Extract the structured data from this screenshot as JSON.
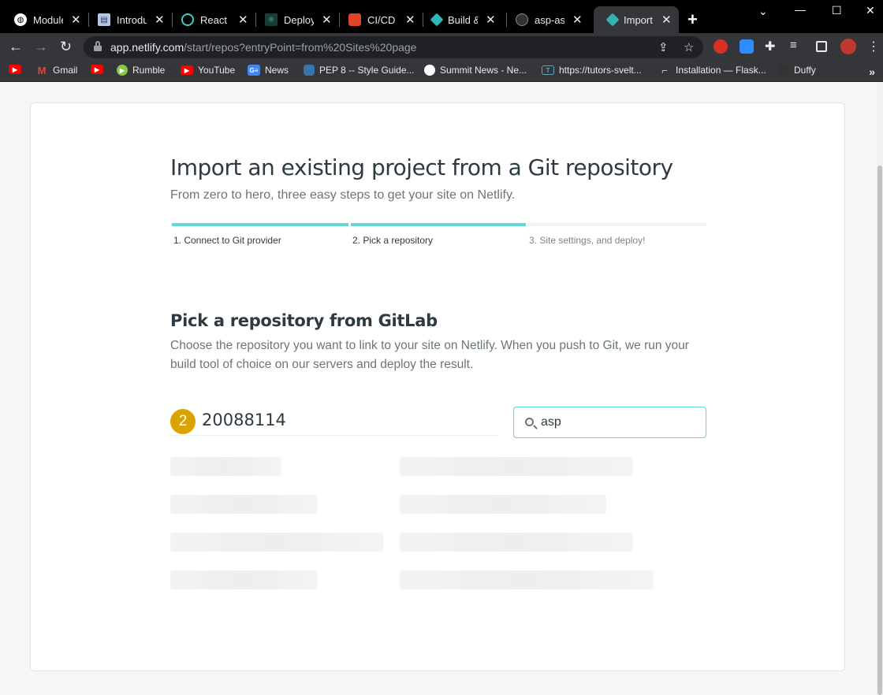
{
  "browser": {
    "tabs": [
      {
        "title": "Module",
        "icon": "globe-icon"
      },
      {
        "title": "Introdu",
        "icon": "book-icon"
      },
      {
        "title": "React Q",
        "icon": "react-query-icon"
      },
      {
        "title": "Deploy",
        "icon": "react-icon"
      },
      {
        "title": "CI/CD S",
        "icon": "gitlab-icon"
      },
      {
        "title": "Build &",
        "icon": "netlify-icon"
      },
      {
        "title": "asp-ass",
        "icon": "github-icon"
      },
      {
        "title": "Import a",
        "icon": "netlify-icon"
      }
    ],
    "url_host": "app.netlify.com",
    "url_path": "/start/repos?entryPoint=from%20Sites%20page",
    "bookmarks": [
      {
        "label": "",
        "icon": "youtube-icon"
      },
      {
        "label": "Gmail",
        "icon": "gmail-icon"
      },
      {
        "label": "",
        "icon": "youtube-icon"
      },
      {
        "label": "Rumble",
        "icon": "rumble-icon"
      },
      {
        "label": "YouTube",
        "icon": "youtube-icon"
      },
      {
        "label": "News",
        "icon": "google-news-icon"
      },
      {
        "label": "PEP 8 -- Style Guide...",
        "icon": "python-icon"
      },
      {
        "label": "Summit News - Ne...",
        "icon": "globe-icon"
      },
      {
        "label": "https://tutors-svelt...",
        "icon": "tutors-icon"
      },
      {
        "label": "Installation — Flask...",
        "icon": "flask-icon"
      },
      {
        "label": "Duffy",
        "icon": "github-icon"
      }
    ],
    "bookmarks_more": "»"
  },
  "page": {
    "title": "Import an existing project from a Git repository",
    "subtitle": "From zero to hero, three easy steps to get your site on Netlify.",
    "steps": [
      {
        "label": "1. Connect to Git provider",
        "state": "complete"
      },
      {
        "label": "2. Pick a repository",
        "state": "current"
      },
      {
        "label": "3. Site settings, and deploy!",
        "state": "pending"
      }
    ],
    "section_title": "Pick a repository from GitLab",
    "section_description": "Choose the repository you want to link to your site on Netlify. When you push to Git, we run your build tool of choice on our servers and deploy the result.",
    "account": {
      "avatar_letter": "2",
      "name": "20088114"
    },
    "search": {
      "value": "asp"
    }
  },
  "colors": {
    "accent": "#5fd7d4",
    "avatar": "#d9a300",
    "text": "#2d3b41",
    "muted": "#6c7578"
  }
}
